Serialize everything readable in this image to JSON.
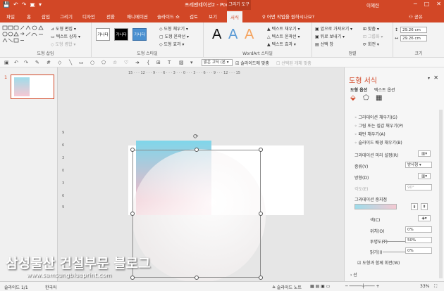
{
  "titlebar": {
    "qat": [
      "💾",
      "↶",
      "↷",
      "▣",
      "▾"
    ],
    "title": "프레젠테이션2 - PowerPoint",
    "context_tab": "그리기 도구",
    "user": "이혜련",
    "win_min": "─",
    "win_max": "□",
    "win_close": "✕"
  },
  "tabs": [
    "파일",
    "홈",
    "삽입",
    "그리기",
    "디자인",
    "전환",
    "애니메이션",
    "슬라이드 쇼",
    "검토",
    "보기",
    "서식"
  ],
  "tellme": "♀ 어떤 작업을 원하시나요?",
  "share": "⚇ 공유",
  "ribbon": {
    "insert_shapes": {
      "edit_shape": "⊿ 도형 편집 ▾",
      "textbox": "▭ 텍스트 상자 ▾",
      "merge": "◇ 도형 병합 ▾",
      "label": "도형 삽입"
    },
    "shape_styles": {
      "samples": [
        "가나다",
        "가나다",
        "가나다"
      ],
      "fill": "◇ 도형 채우기 ▾",
      "outline": "▢ 도형 윤곽선 ▾",
      "effect": "◇ 도형 효과 ▾",
      "label": "도형 스타일"
    },
    "wordart": {
      "letters": [
        "A",
        "A",
        "A"
      ],
      "fill": "▲ 텍스트 채우기 ▾",
      "outline": "△ 텍스트 윤곽선 ▾",
      "effect": "▲ 텍스트 효과 ▾",
      "label": "WordArt 스타일"
    },
    "arrange": {
      "front": "▣ 앞으로 가져오기 ▾",
      "back": "▣ 뒤로 보내기 ▾",
      "select_pane": "▤ 선택 창",
      "align": "⊞ 맞춤 ▾",
      "group": "⊡ 그룹화 ▾",
      "rotate": "⟳ 회전 ▾",
      "label": "정렬"
    },
    "size": {
      "height": "29.26 cm",
      "width": "29.26 cm",
      "label": "크기"
    }
  },
  "toolrow": {
    "font": "맑은 고딕 (본 ▾",
    "chk1": "☑ 슬라이드에 맞춤",
    "chk2": "☐ 선택된 개체 맞춤"
  },
  "thumbnails": {
    "slide_number": "1"
  },
  "ruler": {
    "h": "15 · · · 12 · · · 9 · · · 6 · · · 3 · · · 0 · · · 3 · · · 6 · · · 9 · · · 12 · · · 15",
    "v": [
      "9",
      "6",
      "3",
      "0",
      "3",
      "6",
      "9"
    ]
  },
  "pane": {
    "title": "도형 서식",
    "dropdown": "▾",
    "close": "✕",
    "subtabs": [
      "도형 옵션",
      "텍스트 옵션"
    ],
    "icons": [
      "fill-line-icon",
      "effects-icon",
      "size-icon"
    ],
    "fill_options": [
      "◦ 그라데이션 채우기(G)",
      "◦ 그림 또는 질감 채우기(P)",
      "◦ 패턴 채우기(A)",
      "◦ 슬라이드 배경 채우기(B)"
    ],
    "preset_label": "그라데이션 미리 설정(R)",
    "type_label": "종류(Y)",
    "type_value": "방사형 ▾",
    "direction_label": "방향(D)",
    "angle_label": "각도(E)",
    "angle_value": "90°",
    "stops_label": "그라데이션 중지점",
    "color_label": "색(C)",
    "position_label": "위치(O)",
    "position_value": "0%",
    "transparency_label": "투명도(T)",
    "transparency_value": "50%",
    "brightness_label": "밝기(I)",
    "brightness_value": "0%",
    "rotate_with_shape": "☑ 도형과 함께 회전(W)",
    "line_section": "› 선"
  },
  "status": {
    "slide_info": "슬라이드 1/1",
    "language": "한국어",
    "notes": "≙ 슬라이드 노트",
    "zoom": "33%"
  },
  "watermark": {
    "line1": "삼성물산 건설부문 블로그",
    "line2": "www.samsungblueprint.com"
  }
}
